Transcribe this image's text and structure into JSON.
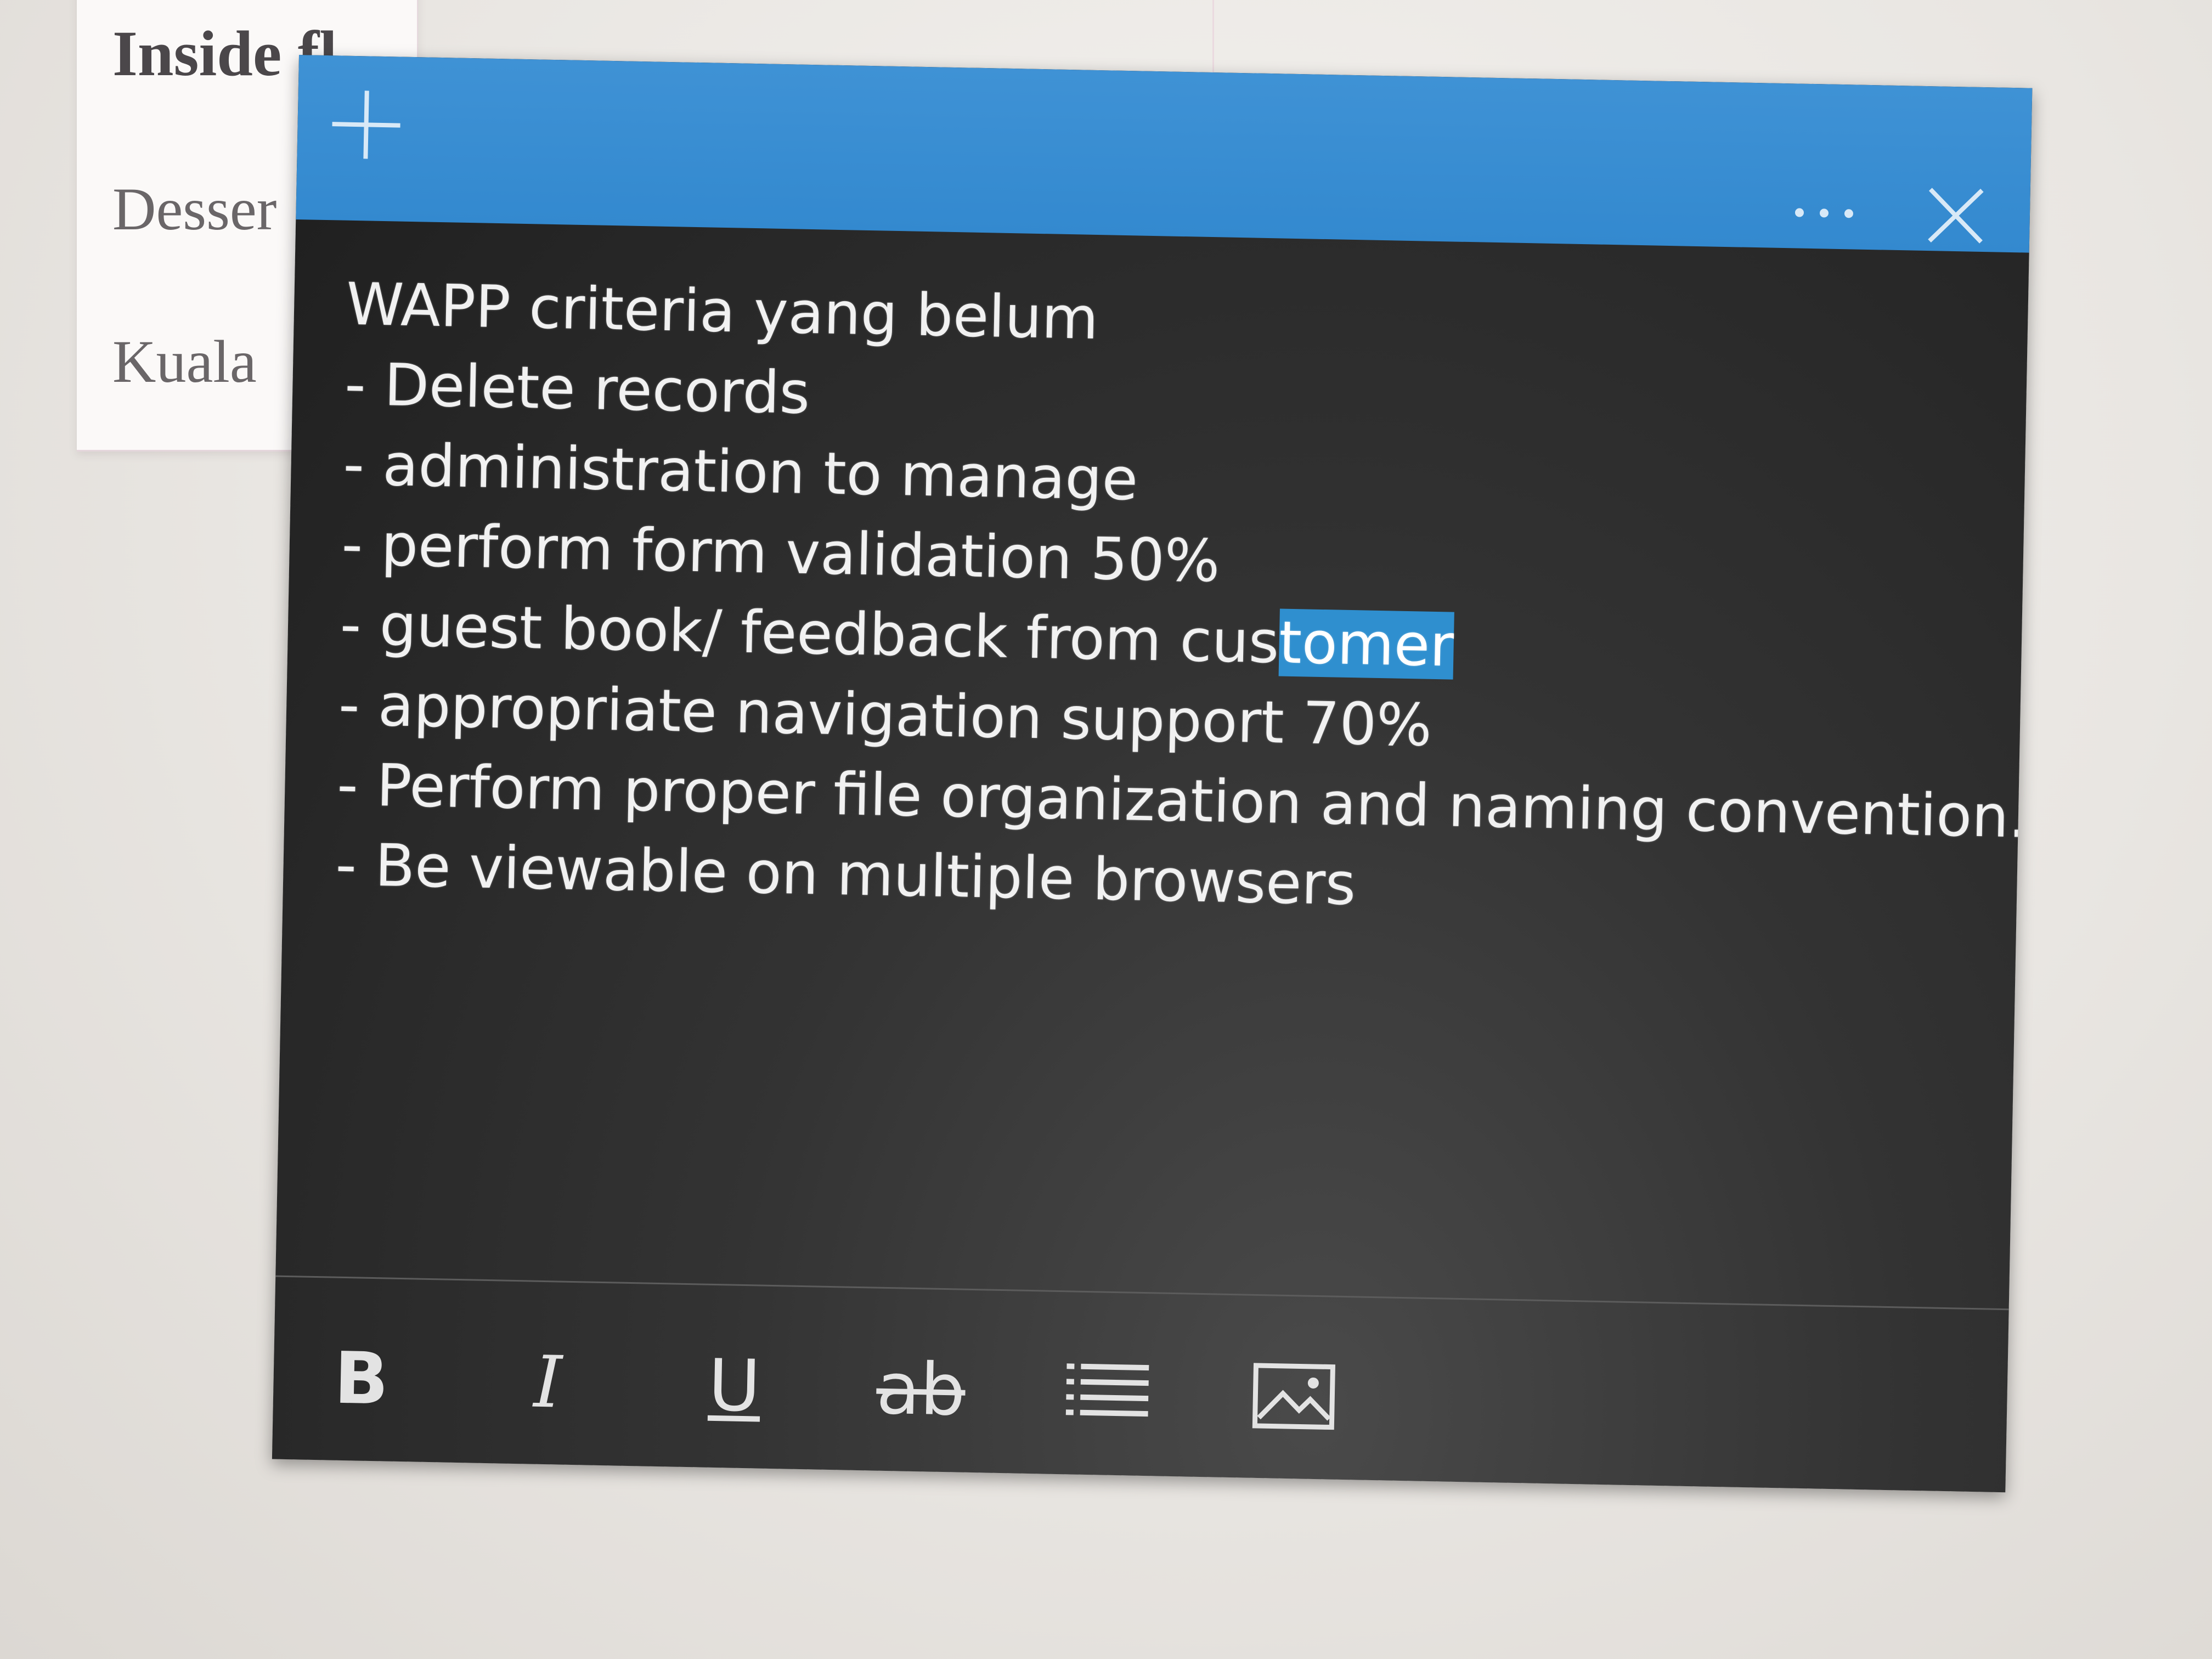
{
  "background": {
    "heading": "Inside fl",
    "line1": "Desser",
    "line2": "Kuala"
  },
  "note": {
    "title_color": "#3389cf",
    "body_color": "#2a2a2a",
    "selection_color": "#2f8fcf",
    "icons": {
      "add": "plus-icon",
      "more": "ellipsis-icon",
      "close": "close-icon"
    },
    "lines": [
      "WAPP criteria yang belum",
      "- Delete records",
      "- administration to manage",
      "- perform form validation 50%",
      "- appropriate navigation support 70%",
      "- Perform proper file organization and naming convention.",
      "- Be viewable on multiple browsers"
    ],
    "highlight_line": {
      "before": "- guest book/ feedback from cus",
      "selected": "tomer"
    }
  },
  "toolbar": {
    "bold_label": "B",
    "italic_label": "I",
    "underline_label": "U",
    "strike_label": "ab",
    "list_icon": "bullet-list-icon",
    "image_icon": "image-icon"
  }
}
